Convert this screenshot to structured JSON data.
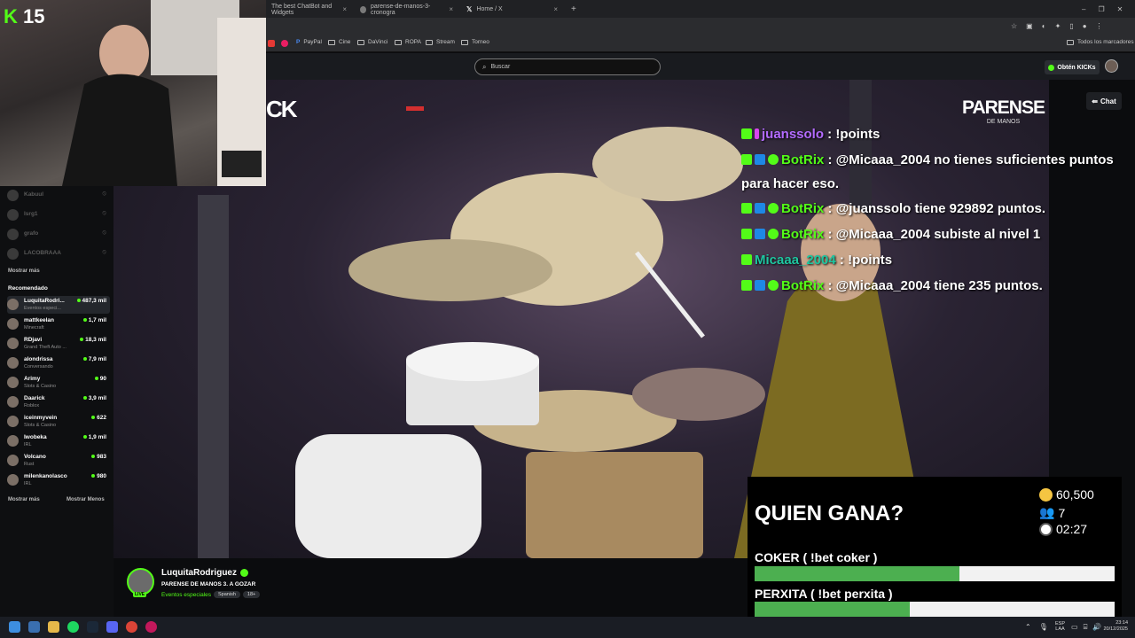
{
  "browser": {
    "tabs": [
      {
        "label": "The best ChatBot and Widgets"
      },
      {
        "label": "parense-de-manos-3-cronogra"
      },
      {
        "label": "Home / X"
      }
    ],
    "bookmarks": [
      {
        "label": "PayPal"
      },
      {
        "label": "Cine"
      },
      {
        "label": "DaVinci"
      },
      {
        "label": "ROPA"
      },
      {
        "label": "Stream"
      },
      {
        "label": "Torneo"
      }
    ],
    "bookmarks_all": "Todos los marcadores"
  },
  "kick": {
    "search_placeholder": "Buscar",
    "obten_label": "Obtén KICKs",
    "chat_label": "Chat",
    "logo_text": "CK",
    "event_logo_top": "PARENSE",
    "event_logo_bottom": "DE MANOS"
  },
  "webcam": {
    "k_letter": "K",
    "level": "15"
  },
  "sidebar": {
    "offline": [
      {
        "name": "Kabuul"
      },
      {
        "name": "lsrg1"
      },
      {
        "name": "grafo"
      },
      {
        "name": "LACOBRAAA"
      }
    ],
    "show_more": "Mostrar más",
    "recommended_title": "Recomendado",
    "recommended": [
      {
        "name": "LuquitaRodri...",
        "category": "Eventos especi...",
        "viewers": "487,3 mil"
      },
      {
        "name": "mattkeelan",
        "category": "Minecraft",
        "viewers": "1,7 mil"
      },
      {
        "name": "RDjavi",
        "category": "Grand Theft Auto ...",
        "viewers": "18,3 mil"
      },
      {
        "name": "alondrissa",
        "category": "Conversando",
        "viewers": "7,9 mil"
      },
      {
        "name": "Arimy",
        "category": "Slots & Casino",
        "viewers": "90"
      },
      {
        "name": "Daarick",
        "category": "Roblox",
        "viewers": "3,9 mil"
      },
      {
        "name": "iceinmyvein",
        "category": "Slots & Casino",
        "viewers": "622"
      },
      {
        "name": "Iwobeka",
        "category": "IRL",
        "viewers": "1,9 mil"
      },
      {
        "name": "Volcano",
        "category": "Rust",
        "viewers": "983"
      },
      {
        "name": "milenkanolasco",
        "category": "IRL",
        "viewers": "980"
      }
    ],
    "show_more_bottom": "Mostrar más",
    "show_less": "Mostrar Menos"
  },
  "chat": [
    {
      "user": "juanssolo",
      "color": "#b36bff",
      "text": " : !points"
    },
    {
      "user": "BotRix",
      "color": "#53fc18",
      "text": " : @Micaaa_2004 no tienes suficientes puntos",
      "text2": "para hacer eso."
    },
    {
      "user": "BotRix",
      "color": "#53fc18",
      "text": " : @juanssolo tiene 929892 puntos."
    },
    {
      "user": "BotRix",
      "color": "#53fc18",
      "text": " : @Micaaa_2004 subiste al nivel 1"
    },
    {
      "user": "Micaaa_2004",
      "color": "#1ec6a0",
      "text": " : !points"
    },
    {
      "user": "BotRix",
      "color": "#53fc18",
      "text": " : @Micaaa_2004 tiene 235 puntos."
    }
  ],
  "bet": {
    "question": "QUIEN GANA?",
    "pot": "60,500",
    "bettors": "7",
    "time": "02:27",
    "options": [
      {
        "label": "COKER ( !bet coker )",
        "fraction": 0.57
      },
      {
        "label": "PERXITA ( !bet perxita )",
        "fraction": 0.43
      }
    ]
  },
  "stream": {
    "streamer": "LuquitaRodriguez",
    "title": "PARENSE DE MANOS 3. A GOZAR",
    "category": "Eventos especiales",
    "tags": [
      "Spanish",
      "18+"
    ],
    "live_badge": "LIVE"
  },
  "taskbar": {
    "lang": "ESP",
    "lang2": "LAA",
    "time": "23:14",
    "date": "20/12/2025"
  }
}
